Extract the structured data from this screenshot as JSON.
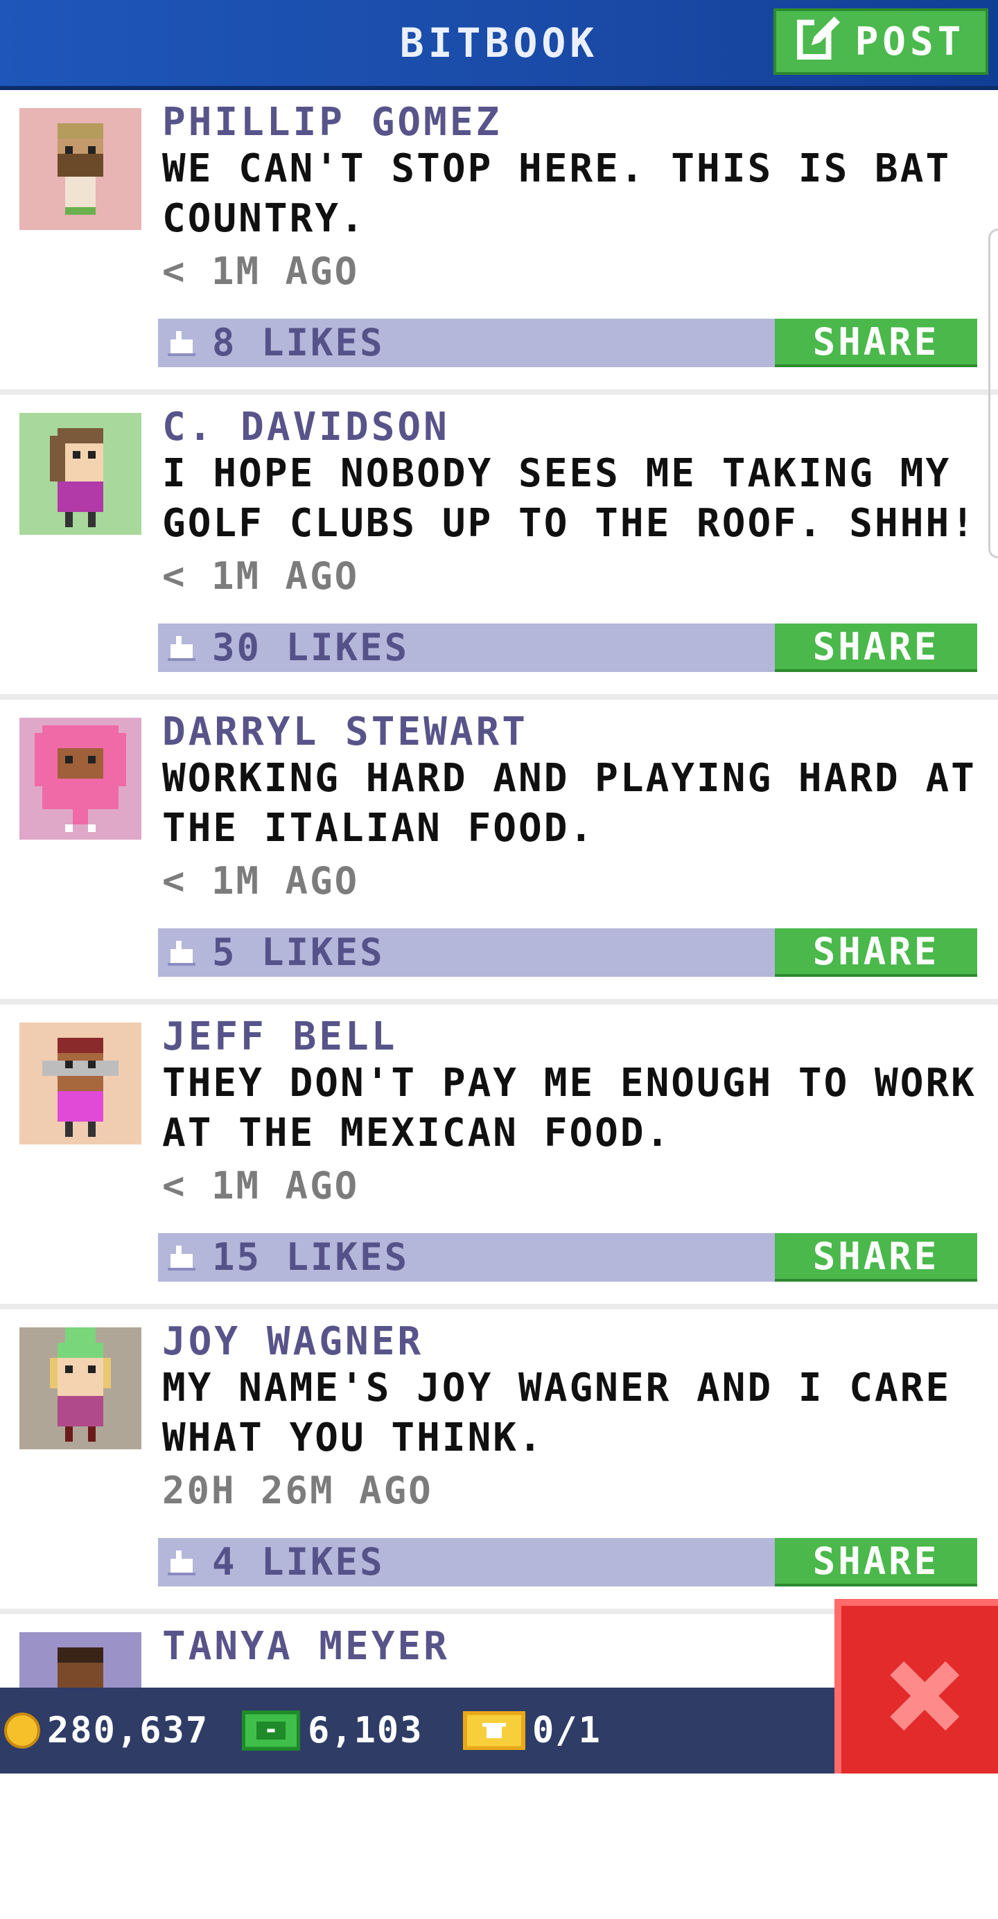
{
  "header": {
    "title": "BITBOOK",
    "post_label": "POST",
    "post_icon": "edit-icon"
  },
  "posts": [
    {
      "author": "PHILLIP GOMEZ",
      "message": "WE CAN'T STOP HERE. THIS IS BAT COUNTRY.",
      "time": "< 1M AGO",
      "likes": "8 LIKES",
      "share": "SHARE",
      "avatar_bg": "#e8b4b4"
    },
    {
      "author": "C. DAVIDSON",
      "message": "I HOPE NOBODY SEES ME TAKING MY GOLF CLUBS UP TO THE ROOF. SHHH!",
      "time": "< 1M AGO",
      "likes": "30 LIKES",
      "share": "SHARE",
      "avatar_bg": "#a8d89b"
    },
    {
      "author": "DARRYL STEWART",
      "message": "WORKING HARD AND PLAYING HARD AT THE ITALIAN FOOD.",
      "time": "< 1M AGO",
      "likes": "5 LIKES",
      "share": "SHARE",
      "avatar_bg": "#e0a8c8"
    },
    {
      "author": "JEFF BELL",
      "message": "THEY DON'T PAY ME ENOUGH TO WORK AT THE MEXICAN FOOD.",
      "time": "< 1M AGO",
      "likes": "15 LIKES",
      "share": "SHARE",
      "avatar_bg": "#f0cdb0"
    },
    {
      "author": "JOY WAGNER",
      "message": "MY NAME'S JOY WAGNER AND I CARE WHAT YOU THINK.",
      "time": "20H 26M AGO",
      "likes": "4 LIKES",
      "share": "SHARE",
      "avatar_bg": "#b0a698"
    },
    {
      "author": "TANYA MEYER",
      "avatar_bg": "#9b92c8"
    }
  ],
  "footer": {
    "coins": "280,637",
    "bux": "6,103",
    "vip": "0/1"
  },
  "colors": {
    "header_blue": "#1e56b9",
    "accent_green": "#4ab84b",
    "likes_bar": "#b4b7d9",
    "close_red": "#e32b2b"
  }
}
